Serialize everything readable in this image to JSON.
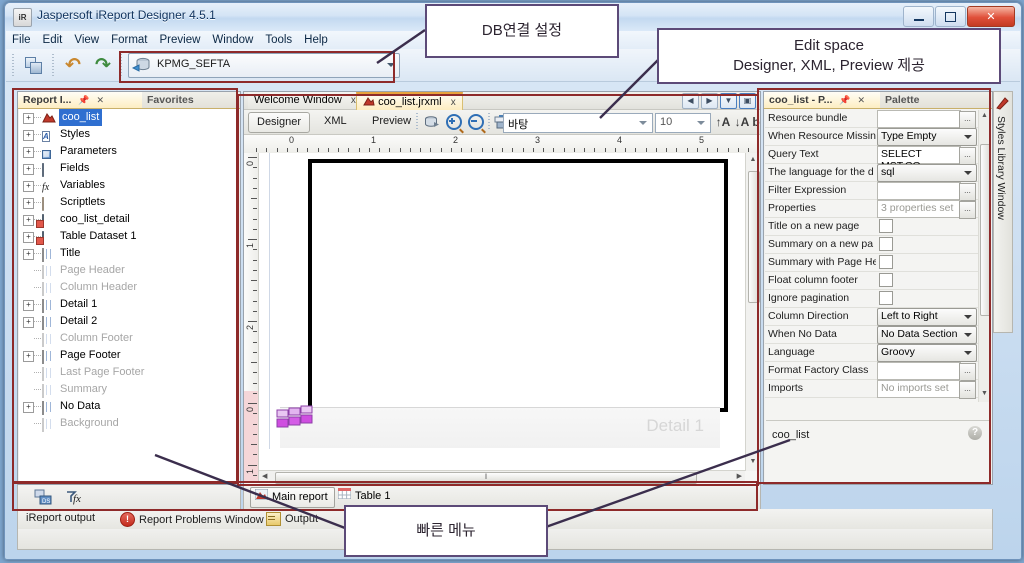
{
  "window": {
    "title": "Jaspersoft iReport Designer 4.5.1",
    "icon": "ireport-app-icon",
    "controls": {
      "minimize": "Minimize",
      "maximize": "Maximize",
      "close": "Close"
    }
  },
  "menubar": {
    "items": [
      {
        "label": "File"
      },
      {
        "label": "Edit"
      },
      {
        "label": "View"
      },
      {
        "label": "Format"
      },
      {
        "label": "Preview"
      },
      {
        "label": "Window"
      },
      {
        "label": "Tools"
      },
      {
        "label": "Help"
      }
    ]
  },
  "toolbar": {
    "buttons": [
      {
        "name": "copy-report-button",
        "label": "Copy"
      },
      {
        "name": "undo-button",
        "label": "Undo"
      },
      {
        "name": "redo-button",
        "label": "Redo"
      }
    ],
    "connection": {
      "label": "KPMG_SEFTA",
      "icon": "database-connection-icon"
    }
  },
  "left_panel": {
    "tabs": [
      {
        "label": "Report I...",
        "active": true
      },
      {
        "label": "Favorites",
        "active": false
      }
    ],
    "tree": [
      {
        "label": "coo_list",
        "icon": "report-icon",
        "expandable": true,
        "dim": false,
        "root": true
      },
      {
        "label": "Styles",
        "icon": "styles-icon",
        "expandable": true,
        "dim": false
      },
      {
        "label": "Parameters",
        "icon": "parameters-icon",
        "expandable": true,
        "dim": false
      },
      {
        "label": "Fields",
        "icon": "fields-icon",
        "expandable": true,
        "dim": false
      },
      {
        "label": "Variables",
        "icon": "variables-icon",
        "expandable": true,
        "dim": false
      },
      {
        "label": "Scriptlets",
        "icon": "scriptlets-icon",
        "expandable": true,
        "dim": false
      },
      {
        "label": "coo_list_detail",
        "icon": "dataset-icon",
        "expandable": true,
        "dim": false
      },
      {
        "label": "Table Dataset 1",
        "icon": "dataset-icon",
        "expandable": true,
        "dim": false
      },
      {
        "label": "Title",
        "icon": "band-icon",
        "expandable": true,
        "dim": false
      },
      {
        "label": "Page Header",
        "icon": "band-icon",
        "expandable": false,
        "dim": true
      },
      {
        "label": "Column Header",
        "icon": "band-icon",
        "expandable": false,
        "dim": true
      },
      {
        "label": "Detail 1",
        "icon": "band-icon",
        "expandable": true,
        "dim": false
      },
      {
        "label": "Detail 2",
        "icon": "band-icon",
        "expandable": true,
        "dim": false
      },
      {
        "label": "Column Footer",
        "icon": "band-icon",
        "expandable": false,
        "dim": true
      },
      {
        "label": "Page Footer",
        "icon": "band-icon",
        "expandable": true,
        "dim": false
      },
      {
        "label": "Last Page Footer",
        "icon": "band-icon",
        "expandable": false,
        "dim": true
      },
      {
        "label": "Summary",
        "icon": "band-icon",
        "expandable": false,
        "dim": true
      },
      {
        "label": "No Data",
        "icon": "band-icon",
        "expandable": true,
        "dim": false
      },
      {
        "label": "Background",
        "icon": "band-icon",
        "expandable": false,
        "dim": true
      }
    ],
    "footer_tools": [
      {
        "name": "add-dataset-icon",
        "label": "Add dataset"
      },
      {
        "name": "expression-icon",
        "label": "fx"
      }
    ]
  },
  "editor": {
    "document_tabs": [
      {
        "label": "Welcome Window",
        "active": false,
        "close": "x"
      },
      {
        "label": "coo_list.jrxml",
        "active": true,
        "close": "x"
      }
    ],
    "tab_nav": [
      {
        "name": "tab-scroll-left-button",
        "glyph": "◀"
      },
      {
        "name": "tab-scroll-right-button",
        "glyph": "▶"
      },
      {
        "name": "tab-list-button",
        "glyph": "▼"
      },
      {
        "name": "maximize-editor-button",
        "glyph": "▣"
      }
    ],
    "view_tabs": [
      {
        "label": "Designer",
        "active": true
      },
      {
        "label": "XML",
        "active": false
      },
      {
        "label": "Preview",
        "active": false
      }
    ],
    "tool_buttons": [
      {
        "name": "dataset-button",
        "label": "Report query"
      },
      {
        "name": "zoom-in-button",
        "label": "Zoom in"
      },
      {
        "name": "zoom-out-button",
        "label": "Zoom out"
      },
      {
        "name": "format-button",
        "label": "Format"
      }
    ],
    "font_name": "바탕",
    "font_size": "10",
    "font_buttons": [
      {
        "name": "increase-font-button",
        "glyph": "↑A"
      },
      {
        "name": "decrease-font-button",
        "glyph": "↓A"
      },
      {
        "name": "bold-button",
        "glyph": "b"
      }
    ],
    "ruler_h": [
      "0",
      "1",
      "2",
      "3",
      "4",
      "5"
    ],
    "ruler_v": [
      "0",
      "1",
      "2",
      "0",
      "1"
    ],
    "band_label": "Detail 1",
    "scroll_grip": "‖"
  },
  "bottom_tabs": [
    {
      "label": "Main report",
      "icon": "main-report-icon",
      "active": true
    },
    {
      "label": "Table 1",
      "icon": "table-icon",
      "active": false
    }
  ],
  "right_panel": {
    "tabs": [
      {
        "label": "coo_list - P...",
        "active": true
      },
      {
        "label": "Palette",
        "active": false
      }
    ],
    "properties": [
      {
        "key": "Resource bundle",
        "type": "text-dots",
        "value": ""
      },
      {
        "key": "When Resource Missin",
        "type": "combo",
        "value": "Type Empty"
      },
      {
        "key": "Query Text",
        "type": "text-dots",
        "value": "SELECT MST.CO…"
      },
      {
        "key": "The language for the d",
        "type": "combo",
        "value": "sql"
      },
      {
        "key": "Filter Expression",
        "type": "text-dots",
        "value": ""
      },
      {
        "key": "Properties",
        "type": "text-dots",
        "value": "3 properties set",
        "grey": true
      },
      {
        "key": "Title on a new page",
        "type": "checkbox",
        "value": ""
      },
      {
        "key": "Summary on a new pa",
        "type": "checkbox",
        "value": ""
      },
      {
        "key": "Summary with Page He",
        "type": "checkbox",
        "value": ""
      },
      {
        "key": "Float column footer",
        "type": "checkbox",
        "value": ""
      },
      {
        "key": "Ignore pagination",
        "type": "checkbox",
        "value": ""
      },
      {
        "key": "Column Direction",
        "type": "combo",
        "value": "Left to Right"
      },
      {
        "key": "When No Data",
        "type": "combo",
        "value": "No Data Section"
      },
      {
        "key": "Language",
        "type": "combo",
        "value": "Groovy"
      },
      {
        "key": "Format Factory Class",
        "type": "text-dots",
        "value": ""
      },
      {
        "key": "Imports",
        "type": "text-dots",
        "value": "No imports set",
        "grey": true
      }
    ],
    "footer_name": "coo_list",
    "help_glyph": "?"
  },
  "styles_dock": {
    "label": "Styles Library Window",
    "icon": "styles-library-icon"
  },
  "statusbar": {
    "items": [
      {
        "label": "iReport output",
        "icon": "none"
      },
      {
        "label": "Report Problems Window",
        "icon": "error-icon"
      },
      {
        "label": "Output",
        "icon": "output-icon"
      }
    ]
  },
  "annotations": {
    "callouts": [
      {
        "name": "callout-db-connection",
        "text": "DB연결 설정"
      },
      {
        "name": "callout-edit-space",
        "line1": "Edit space",
        "line2": "Designer, XML, Preview 제공"
      },
      {
        "name": "callout-quick-menu",
        "text": "빠른 메뉴"
      }
    ],
    "highlight_color": "#8e2a2a",
    "callout_border_color": "#5c4a78"
  }
}
